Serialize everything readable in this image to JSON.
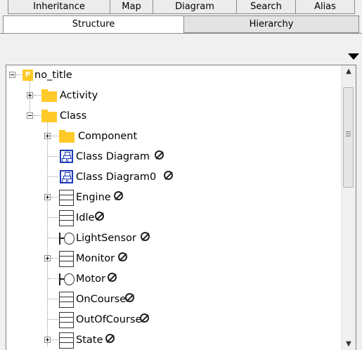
{
  "tabs": {
    "top_row": [
      "Inheritance",
      "Map",
      "Diagram",
      "Search",
      "Alias"
    ],
    "bottom_row": [
      "Structure",
      "Hierarchy"
    ],
    "active": "Structure"
  },
  "tree": {
    "root": {
      "label": "no_title",
      "badge": "P",
      "icon": "package-icon",
      "expanded": true
    },
    "nodes": [
      {
        "label": "Activity",
        "icon": "folder-icon",
        "depth": 1,
        "expander": "plus",
        "disabled_mark": false
      },
      {
        "label": "Class",
        "icon": "folder-icon",
        "depth": 1,
        "expander": "minus",
        "disabled_mark": false
      },
      {
        "label": "Component",
        "icon": "folder-icon",
        "depth": 2,
        "expander": "plus",
        "disabled_mark": false
      },
      {
        "label": "Class Diagram",
        "icon": "class-diagram-icon",
        "depth": 2,
        "expander": "none",
        "disabled_mark": true
      },
      {
        "label": "Class Diagram0",
        "icon": "class-diagram-icon",
        "depth": 2,
        "expander": "none",
        "disabled_mark": true
      },
      {
        "label": "Engine",
        "icon": "class-icon",
        "depth": 2,
        "expander": "plus",
        "disabled_mark": true
      },
      {
        "label": "Idle",
        "icon": "class-icon",
        "depth": 2,
        "expander": "none",
        "disabled_mark": true
      },
      {
        "label": "LightSensor",
        "icon": "interface-icon",
        "depth": 2,
        "expander": "none",
        "disabled_mark": true
      },
      {
        "label": "Monitor",
        "icon": "class-icon",
        "depth": 2,
        "expander": "plus",
        "disabled_mark": true
      },
      {
        "label": "Motor",
        "icon": "interface-icon",
        "depth": 2,
        "expander": "none",
        "disabled_mark": true
      },
      {
        "label": "OnCourse",
        "icon": "class-icon",
        "depth": 2,
        "expander": "none",
        "disabled_mark": true
      },
      {
        "label": "OutOfCourse",
        "icon": "class-icon",
        "depth": 2,
        "expander": "none",
        "disabled_mark": true
      },
      {
        "label": "State",
        "icon": "class-icon",
        "depth": 2,
        "expander": "plus",
        "disabled_mark": true
      }
    ]
  },
  "icons": {
    "dropdown": "triangle-down-icon",
    "disabled_mark": "prohibited-icon",
    "scroll_up": "arrow-up-icon",
    "scroll_down": "arrow-down-icon"
  },
  "colors": {
    "folder": "#ffc928",
    "diagram_icon": "#1e3ab8",
    "window_bg": "#f0f0f0",
    "tree_bg": "#ffffff"
  }
}
